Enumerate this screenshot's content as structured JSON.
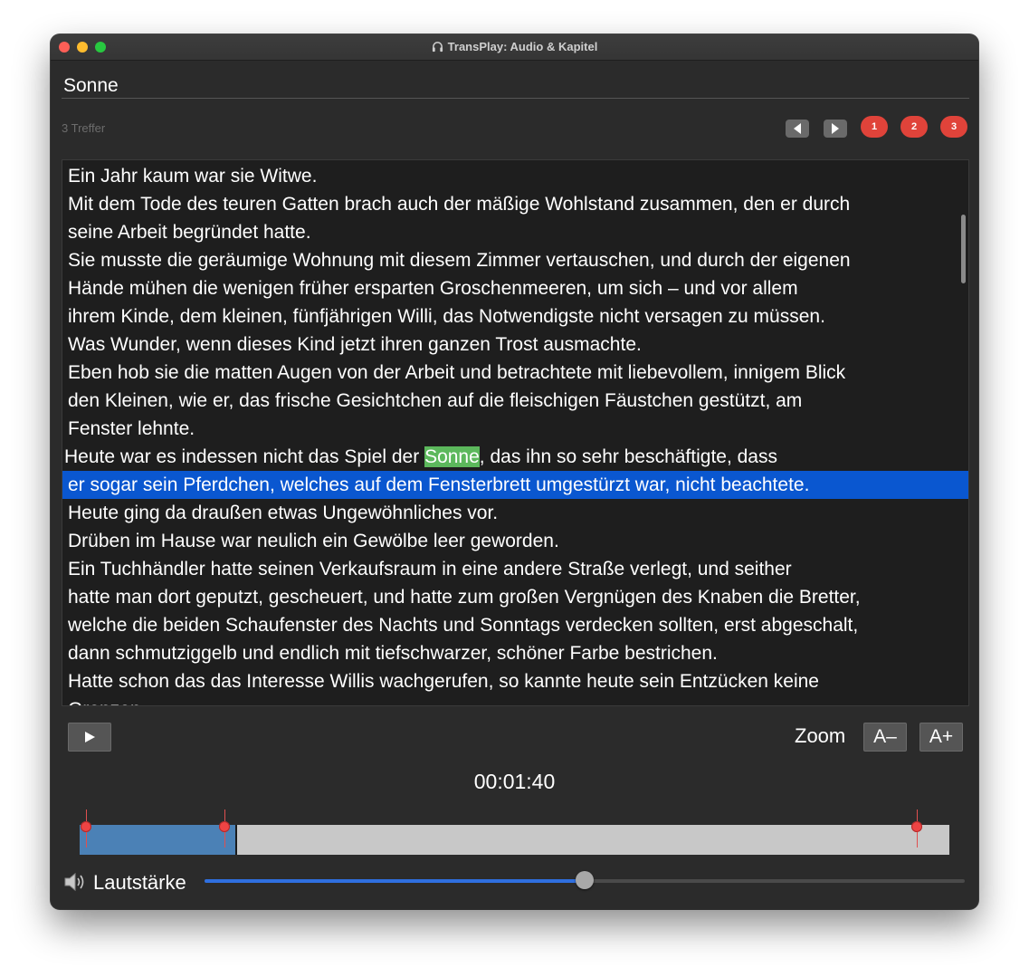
{
  "window": {
    "title": "TransPlay: Audio & Kapitel"
  },
  "search": {
    "value": "Sonne"
  },
  "hits": {
    "count_label": "3 Treffer",
    "badges": [
      "1",
      "2",
      "3"
    ]
  },
  "transcript": {
    "lines": [
      "Ein Jahr kaum war sie Witwe.",
      "Mit dem Tode des teuren Gatten brach auch der mäßige Wohlstand zusammen, den er durch",
      "seine Arbeit begründet hatte.",
      "Sie musste die geräumige Wohnung mit diesem Zimmer vertauschen, und durch der eigenen",
      "Hände mühen die wenigen früher ersparten Groschenmeeren, um sich – und vor allem",
      "ihrem Kinde, dem kleinen, fünfjährigen Willi, das Notwendigste nicht versagen zu müssen.",
      "Was Wunder, wenn dieses Kind jetzt ihren ganzen Trost ausmachte.",
      "Eben hob sie die matten Augen von der Arbeit und betrachtete mit liebevollem, innigem Blick",
      "den Kleinen, wie er, das frische Gesichtchen auf die fleischigen Fäustchen gestützt, am",
      "Fenster lehnte."
    ],
    "match_line": {
      "before": "Heute war es indessen nicht das Spiel der ",
      "match": "Sonne",
      "after": ", das ihn so sehr beschäftigte, dass"
    },
    "selected_line": "er sogar sein Pferdchen, welches auf dem Fensterbrett umgestürzt war, nicht beachtete.",
    "lines_after": [
      "Heute ging da draußen etwas Ungewöhnliches vor.",
      "Drüben im Hause war neulich ein Gewölbe leer geworden.",
      "Ein Tuchhändler hatte seinen Verkaufsraum in eine andere Straße verlegt, und seither",
      "hatte man dort geputzt, gescheuert, und hatte zum großen Vergnügen des Knaben die Bretter,",
      "welche die beiden Schaufenster des Nachts und Sonntags verdecken sollten, erst abgeschalt,",
      "dann schmutziggelb und endlich mit tiefschwarzer, schöner Farbe bestrichen.",
      "Hatte schon das das Interesse Willis wachgerufen, so kannte heute sein Entzücken keine",
      "Grenzen."
    ]
  },
  "controls": {
    "zoom_label": "Zoom",
    "zoom_out": "A–",
    "zoom_in": "A+"
  },
  "player": {
    "time": "00:01:40",
    "progress_fraction": 0.179,
    "chapter_marker_fractions": [
      0.007,
      0.167,
      0.963
    ]
  },
  "volume": {
    "label": "Lautstärke",
    "level_fraction": 0.5
  },
  "colors": {
    "highlight_match": "#5cb85c",
    "selection": "#0a57d0",
    "hit_badge": "#e0433a",
    "played": "#4b81b6",
    "volume_fill": "#2f6fe0"
  },
  "icons": [
    "headphones-icon",
    "previous-hit-icon",
    "next-hit-icon",
    "play-icon",
    "speaker-icon"
  ]
}
